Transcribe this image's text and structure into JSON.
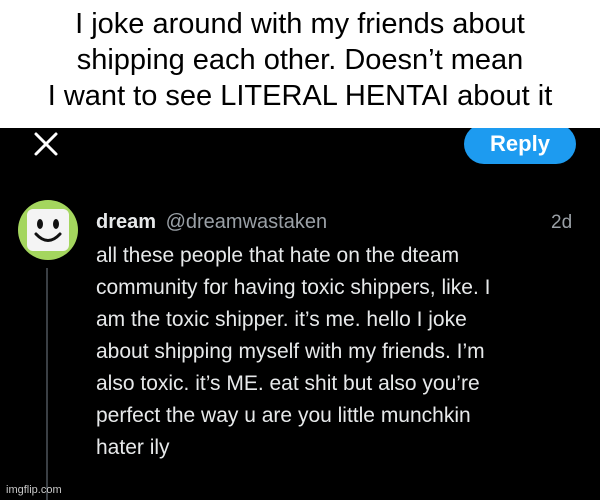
{
  "caption": {
    "lines": [
      "I joke around with my friends about",
      "shipping each other.  Doesn’t mean",
      "I want to see LITERAL HENTAI about it"
    ]
  },
  "toolbar": {
    "close_icon": "close-icon",
    "reply_label": "Reply"
  },
  "tweet": {
    "author_name": "dream",
    "handle": "@dreamwastaken",
    "age": "2d",
    "avatar_icon": "smiley-face-avatar",
    "lines": [
      "all these people that hate on the dteam",
      "community for having toxic shippers, like. I",
      "am the toxic shipper. it’s me. hello I joke",
      "about shipping myself with my friends. I’m",
      "also toxic. it’s ME. eat shit but also you’re",
      "perfect the way u are you little munchkin",
      "hater ily"
    ]
  },
  "watermark": "imgflip.com",
  "colors": {
    "background": "#000000",
    "accent": "#1d9bf0",
    "avatar": "#a4d65e",
    "text": "#e7e9ea",
    "muted": "#9aa0a6"
  }
}
